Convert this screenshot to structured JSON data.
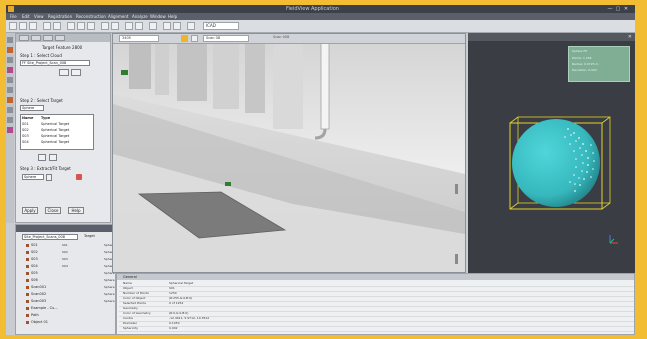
{
  "window": {
    "title": "FieldView Application",
    "controls": [
      "—",
      "▢",
      "✕"
    ]
  },
  "menubar": {
    "items": [
      "File",
      "Edit",
      "View",
      "Registration",
      "Reconstruction",
      "Alignment",
      "Analyze",
      "Window",
      "Help"
    ]
  },
  "toolbar": {
    "coord_field": "ICAD"
  },
  "left_panel": {
    "title": "Target Feature 2800",
    "step1_label": "Step 1 : Select Cloud",
    "step1_value": "FF Site_Project_Scan_008",
    "step2_label": "Step 2 : Select Target",
    "target_type": "Sphere",
    "list_headers": [
      "Name",
      "Type"
    ],
    "targets": [
      {
        "name": "S01",
        "type": "Spherical Target"
      },
      {
        "name": "S02",
        "type": "Spherical Target"
      },
      {
        "name": "S03",
        "type": "Spherical Target"
      },
      {
        "name": "S04",
        "type": "Spherical Target"
      }
    ],
    "step3_label": "Step 3 : Extract/Fit Target",
    "step3_value": "Sphere",
    "buttons": [
      "Apply",
      "Close",
      "Help"
    ]
  },
  "tree_panel": {
    "search_value": "Site_Project_Scans_008",
    "col_header": "Target",
    "items": [
      {
        "name": "S01",
        "col": "S01",
        "flag": "Sphere"
      },
      {
        "name": "S02",
        "col": "S02",
        "flag": "Sphere"
      },
      {
        "name": "S03",
        "col": "S03",
        "flag": "Sphere"
      },
      {
        "name": "S04",
        "col": "S04",
        "flag": "Sphere"
      },
      {
        "name": "S05",
        "col": "",
        "flag": "Sphere"
      },
      {
        "name": "S06",
        "col": "",
        "flag": "Sphere"
      },
      {
        "name": "Scan001",
        "col": "",
        "flag": "Sphere"
      },
      {
        "name": "Scan002",
        "col": "",
        "flag": "Sphere"
      },
      {
        "name": "Scan003",
        "col": "",
        "flag": "Sphere"
      },
      {
        "name": "Example - Cu...",
        "col": "",
        "flag": ""
      },
      {
        "name": "Path",
        "col": "",
        "flag": ""
      },
      {
        "name": "Object 01",
        "col": "",
        "flag": ""
      }
    ]
  },
  "viewport": {
    "tab_title": "Scan 008",
    "scale_field": "3405",
    "mode_field": "Scan 08"
  },
  "view3d": {
    "stats": [
      "Sphere Fit",
      "Points: 1 254",
      "Radius: 0.0725 m",
      "Deviation: 0.002"
    ]
  },
  "properties": {
    "section1": "General",
    "rows": [
      {
        "k": "Name",
        "v": "Spherical Target"
      },
      {
        "k": "Object",
        "v": "S01"
      },
      {
        "k": "Number of Points",
        "v": "1254"
      },
      {
        "k": "Color of Object",
        "v": "(R:255,G:0,B:0)"
      },
      {
        "k": "Selected Points",
        "v": "0 of 1254"
      },
      {
        "k": "Geometry",
        "v": ""
      },
      {
        "k": "Color of Geometry",
        "v": "(R:0,G:0,B:0)"
      },
      {
        "k": "Centre",
        "v": "-12.4011, 5.9712, 10.3512"
      },
      {
        "k": "Diameter",
        "v": "0.1450"
      },
      {
        "k": "Sphericity",
        "v": "0.002"
      }
    ]
  },
  "colors": {
    "frame": "#f2bc33",
    "sphere": "#3fc3c8",
    "bbox": "#e7d32a",
    "stats_panel": "#7fae95"
  }
}
